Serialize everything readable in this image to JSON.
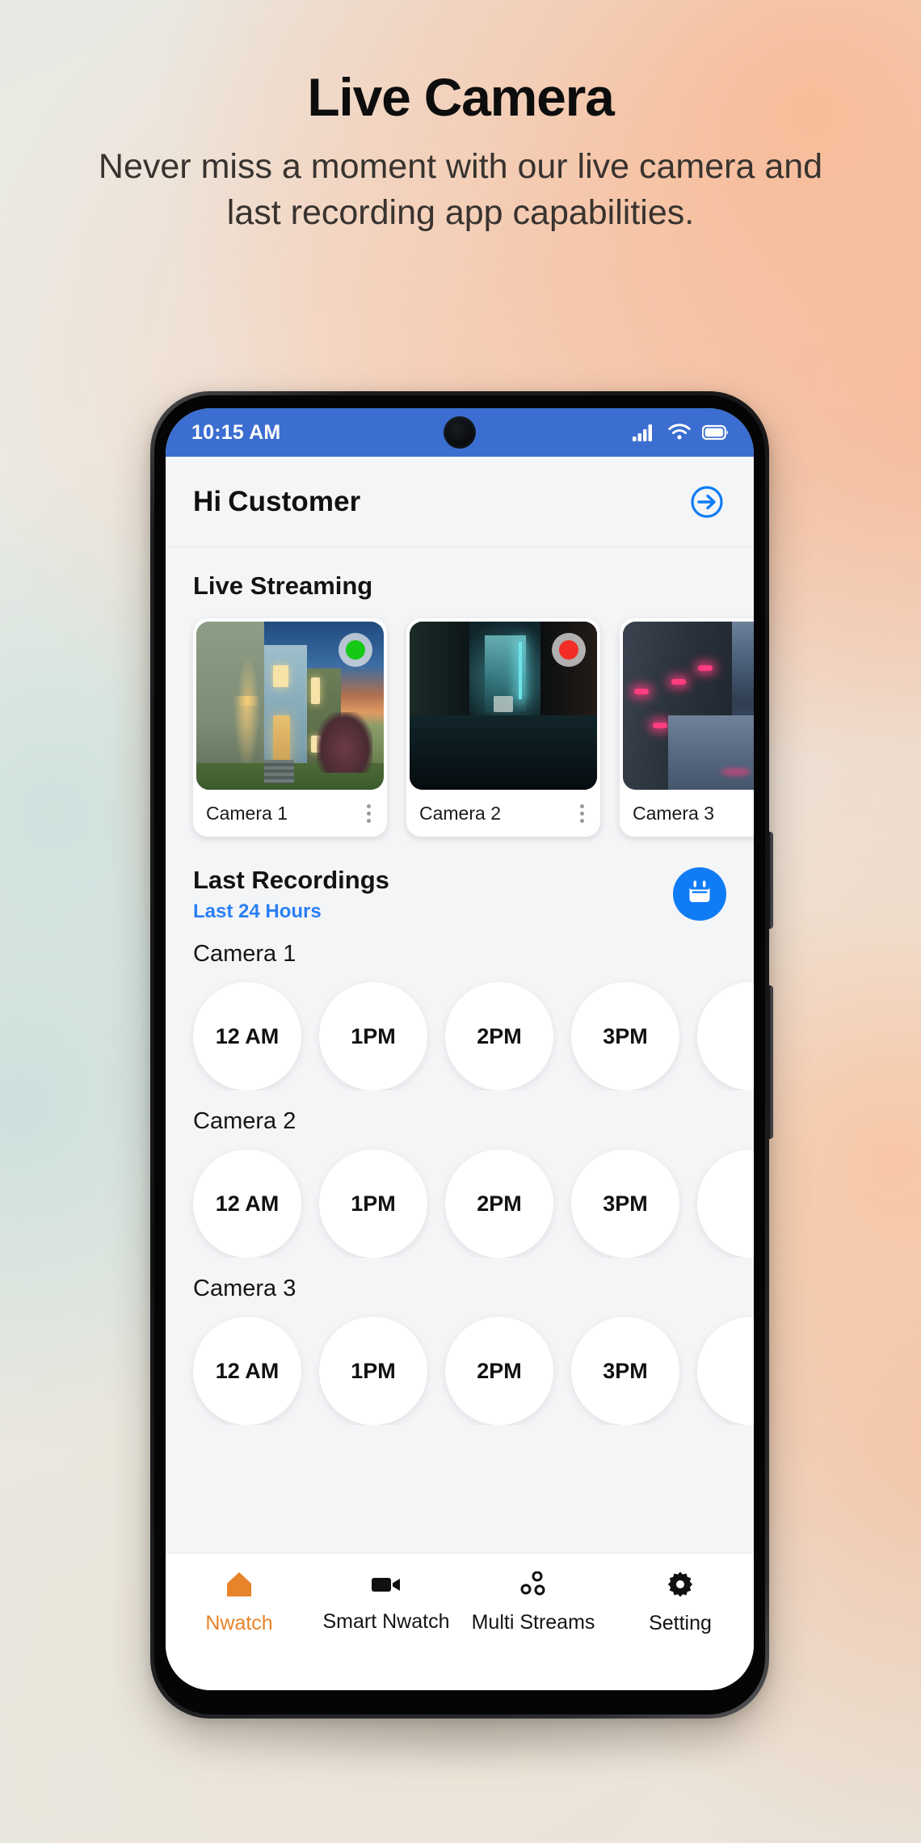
{
  "hero": {
    "title": "Live Camera",
    "subtitle": "Never miss a moment with our live camera and last recording app capabilities."
  },
  "colors": {
    "status_bar": "#3b6ed0",
    "accent_blue": "#0f7cf5",
    "link_blue": "#2a7ff5",
    "active_nav": "#e8832a",
    "live_dot": "#16c916",
    "rec_dot": "#f22d25",
    "screen_bg": "#f4f5f7"
  },
  "status_bar": {
    "time": "10:15 AM",
    "icons": [
      "signal-icon",
      "wifi-icon",
      "battery-icon"
    ]
  },
  "header": {
    "greeting_hi": "Hi",
    "greeting_name": "Customer",
    "action_icon": "logout-arrow-circle-icon"
  },
  "live_streaming": {
    "title": "Live Streaming",
    "cameras": [
      {
        "name": "Camera 1",
        "status": "live",
        "status_icon": "green-dot-icon",
        "scene": "house",
        "menu_icon": "more-vertical-icon"
      },
      {
        "name": "Camera 2",
        "status": "recording",
        "status_icon": "red-dot-icon",
        "scene": "alley",
        "menu_icon": "more-vertical-icon"
      },
      {
        "name": "Camera 3",
        "status": "none",
        "status_icon": "",
        "scene": "street",
        "menu_icon": "more-vertical-icon"
      }
    ]
  },
  "last_recordings": {
    "title": "Last Recordings",
    "subtitle": "Last 24 Hours",
    "calendar_icon": "calendar-icon",
    "groups": [
      {
        "label": "Camera 1",
        "times": [
          "12 AM",
          "1PM",
          "2PM",
          "3PM"
        ]
      },
      {
        "label": "Camera 2",
        "times": [
          "12 AM",
          "1PM",
          "2PM",
          "3PM"
        ]
      },
      {
        "label": "Camera 3",
        "times": [
          "12 AM",
          "1PM",
          "2PM",
          "3PM"
        ]
      }
    ]
  },
  "bottom_nav": {
    "items": [
      {
        "label": "Nwatch",
        "icon": "home-icon",
        "active": true
      },
      {
        "label": "Smart Nwatch",
        "icon": "video-camera-icon",
        "active": false
      },
      {
        "label": "Multi Streams",
        "icon": "multi-nodes-icon",
        "active": false
      },
      {
        "label": "Setting",
        "icon": "gear-icon",
        "active": false
      }
    ]
  }
}
